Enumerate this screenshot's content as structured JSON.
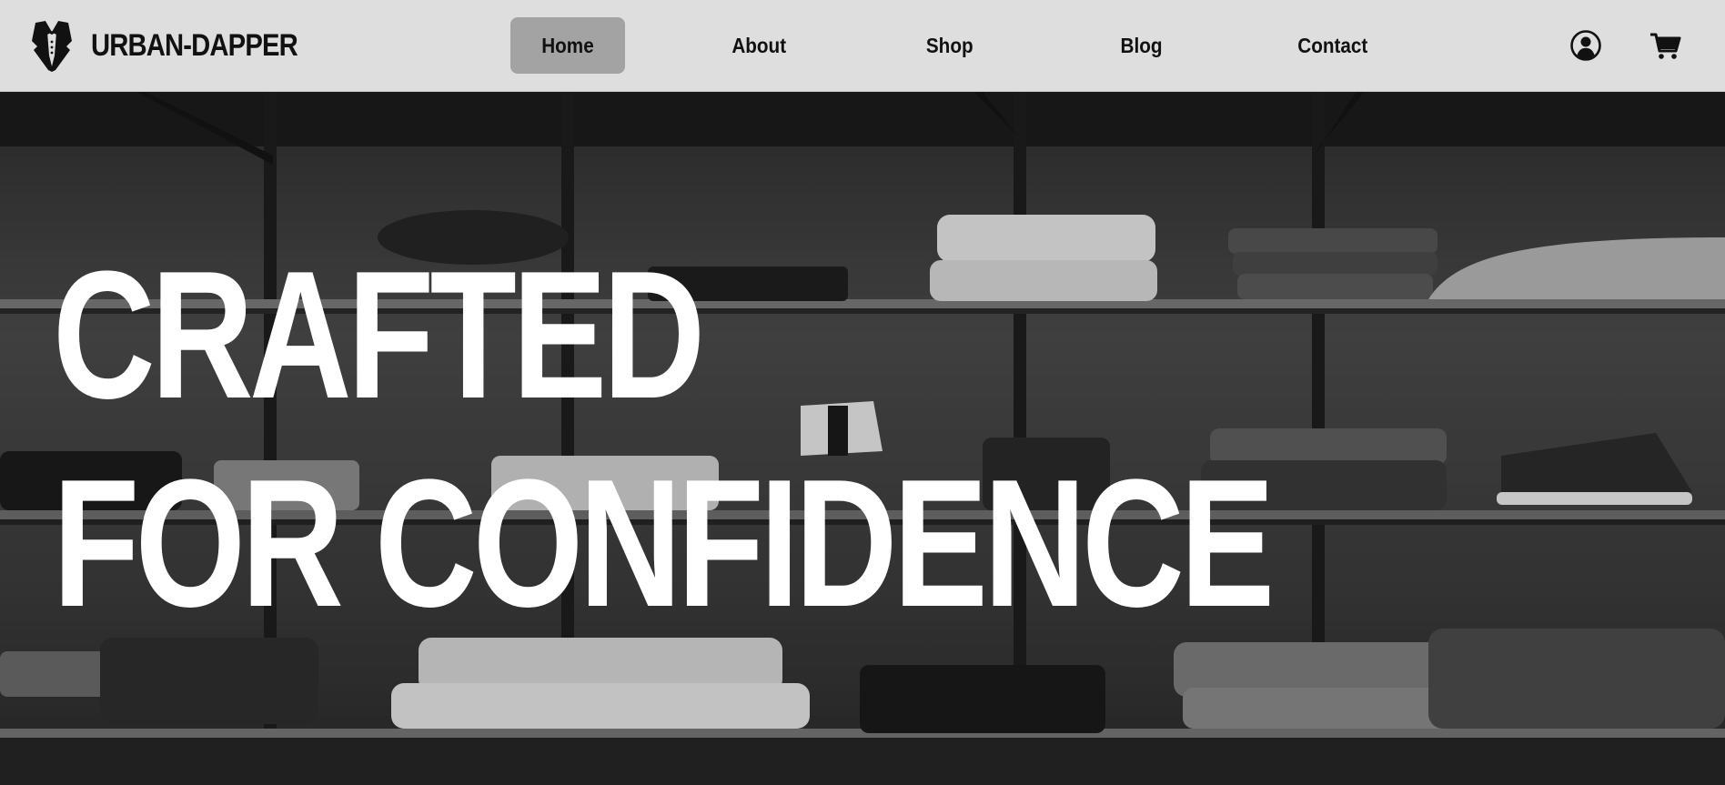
{
  "brand": {
    "name": "URBAN-DAPPER",
    "logo_icon": "tuxedo-icon"
  },
  "nav": {
    "items": [
      {
        "label": "Home",
        "active": true
      },
      {
        "label": "About",
        "active": false
      },
      {
        "label": "Shop",
        "active": false
      },
      {
        "label": "Blog",
        "active": false
      },
      {
        "label": "Contact",
        "active": false
      }
    ],
    "account_icon": "user-circle-icon",
    "cart_icon": "shopping-cart-icon"
  },
  "hero": {
    "headline_line1": "CRAFTED",
    "headline_line2": "FOR CONFIDENCE",
    "background": "black-and-white photo of folded clothes and shoes on store shelves"
  },
  "colors": {
    "navbar_bg": "#dedede",
    "active_nav_bg": "#a3a3a3",
    "text_dark": "#111111",
    "headline": "#ffffff"
  }
}
